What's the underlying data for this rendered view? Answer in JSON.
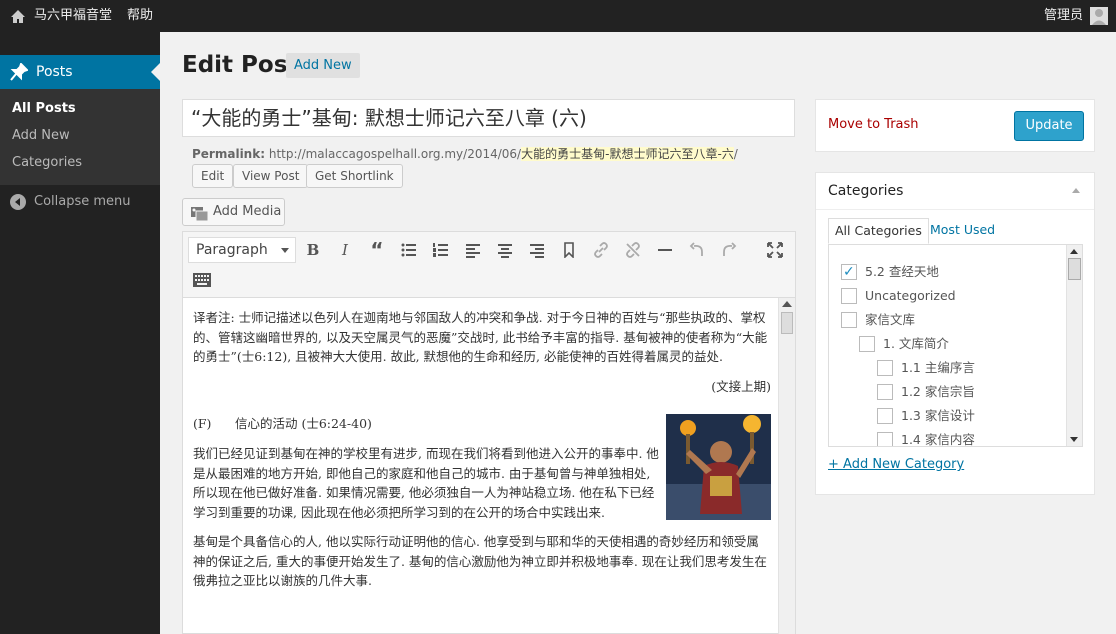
{
  "adminbar": {
    "site_name": "马六甲福音堂",
    "help": "帮助",
    "user": "管理员"
  },
  "menu": {
    "posts": "Posts",
    "submenu": [
      "All Posts",
      "Add New",
      "Categories"
    ],
    "collapse": "Collapse menu"
  },
  "page": {
    "title": "Edit Post",
    "add_new": "Add New",
    "post_title": "“大能的勇士”基甸: 默想士师记六至八章 (六)",
    "permalink_label": "Permalink:",
    "permalink_base": "http://malaccagospelhall.org.my/2014/06/",
    "permalink_slug": "大能的勇士基甸-默想士师记六至八章-六",
    "permalink_tail": "/",
    "btn_edit": "Edit",
    "btn_view": "View Post",
    "btn_shortlink": "Get Shortlink",
    "add_media": "Add Media"
  },
  "editor": {
    "format": "Paragraph",
    "intro": "译者注: 士师记描述以色列人在迦南地与邻国敌人的冲突和争战. 对于今日神的百姓与“那些执政的、掌权的、管辖这幽暗世界的, 以及天空属灵气的恶魔”交战时, 此书给予丰富的指导. 基甸被神的使者称为“大能的勇士”(士6:12), 且被神大大使用. 故此, 默想他的生命和经历, 必能使神的百姓得着属灵的益处.",
    "continued": "(文接上期)",
    "section_label": "(F)",
    "section_title": "信心的活动 (士6:24-40)",
    "para1": "我们已经见证到基甸在神的学校里有进步, 而现在我们将看到他进入公开的事奉中. 他是从最困难的地方开始, 即他自己的家庭和他自己的城市. 由于基甸曾与神单独相处, 所以现在他已做好准备. 如果情况需要, 他必须独自一人为神站稳立场. 他在私下已经学习到重要的功课, 因此现在他必须把所学习到的在公开的场合中实践出来.",
    "para2": "基甸是个具备信心的人, 他以实际行动证明他的信心. 他享受到与耶和华的天使相遇的奇妙经历和领受属神的保证之后, 重大的事便开始发生了. 基甸的信心激励他为神立即并积极地事奉. 现在让我们思考发生在俄弗拉之亚比以谢族的几件大事."
  },
  "publish": {
    "trash": "Move to Trash",
    "update": "Update"
  },
  "categories": {
    "title": "Categories",
    "tab_all": "All Categories",
    "tab_used": "Most Used",
    "items": [
      {
        "name": "5.2 查经天地",
        "checked": true
      },
      {
        "name": "Uncategorized",
        "checked": false
      },
      {
        "name": "家信文库",
        "checked": false
      },
      {
        "name": "1. 文库简介",
        "checked": false
      },
      {
        "name": "1.1 主编序言",
        "checked": false
      },
      {
        "name": "1.2 家信宗旨",
        "checked": false
      },
      {
        "name": "1.3 家信设计",
        "checked": false
      },
      {
        "name": "1.4 家信内容",
        "checked": false
      }
    ],
    "add_new": "+ Add New Category"
  }
}
